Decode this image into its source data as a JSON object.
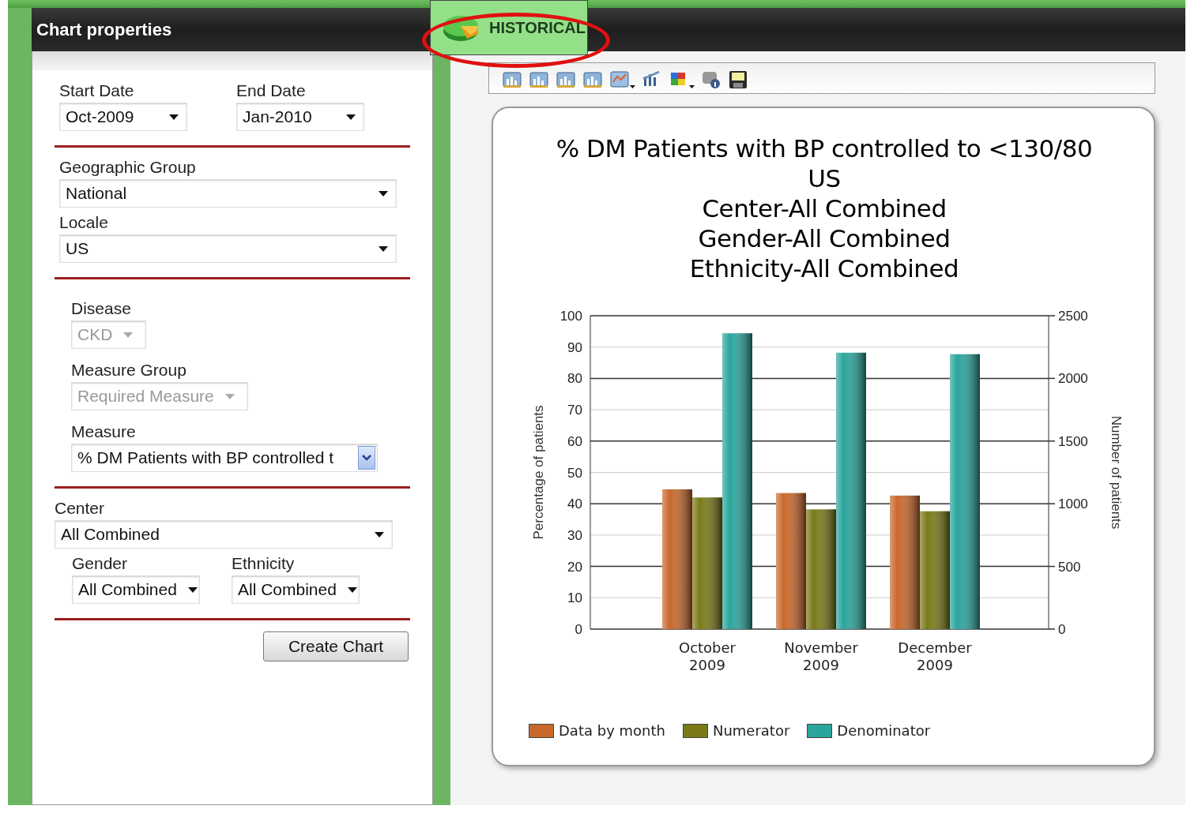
{
  "panel": {
    "title": "Chart properties"
  },
  "tab": {
    "label": "HISTORICAL",
    "selected": true
  },
  "form": {
    "sections": [
      {
        "rows": [
          [
            {
              "label": "Start Date",
              "value": "Oct-2009",
              "kind": "dropdown",
              "disabled": false
            },
            {
              "label": "End Date",
              "value": "Jan-2010",
              "kind": "dropdown",
              "disabled": false
            }
          ]
        ]
      },
      {
        "rows": [
          [
            {
              "label": "Geographic Group",
              "value": "National",
              "kind": "dropdown",
              "disabled": false
            }
          ],
          [
            {
              "label": "Locale",
              "value": "US",
              "kind": "dropdown",
              "disabled": false
            }
          ]
        ]
      },
      {
        "rows": [
          [
            {
              "label": "Disease",
              "value": "CKD",
              "kind": "dropdown",
              "disabled": true
            }
          ],
          [
            {
              "label": "Measure Group",
              "value": "Required Measure",
              "kind": "dropdown",
              "disabled": true
            }
          ],
          [
            {
              "label": "Measure",
              "value": "% DM Patients with BP controlled t",
              "kind": "combo",
              "disabled": false
            }
          ]
        ]
      },
      {
        "rows": [
          [
            {
              "label": "Center",
              "value": "All Combined",
              "kind": "dropdown",
              "disabled": false
            }
          ],
          [
            {
              "label": "Gender",
              "value": "All Combined",
              "kind": "dropdown",
              "disabled": false
            },
            {
              "label": "Ethnicity",
              "value": "All Combined",
              "kind": "dropdown",
              "disabled": false
            }
          ]
        ]
      }
    ],
    "button": "Create Chart"
  },
  "toolbar": [
    {
      "kind": "bars",
      "menu": false
    },
    {
      "kind": "bars",
      "menu": false
    },
    {
      "kind": "bars",
      "menu": false
    },
    {
      "kind": "bars",
      "menu": false
    },
    {
      "kind": "linechart",
      "menu": true
    },
    {
      "kind": "trend",
      "menu": false
    },
    {
      "kind": "palette",
      "menu": true
    },
    {
      "kind": "info",
      "menu": false
    },
    {
      "kind": "save",
      "menu": false
    }
  ],
  "chart_data": {
    "type": "bar",
    "title": "% DM Patients with BP controlled to <130/80\nUS\nCenter-All Combined\nGender-All Combined\nEthnicity-All Combined",
    "ylabel": "Percentage of patients",
    "y2label": "Number of patients",
    "categories": [
      "October\n2009",
      "November\n2009",
      "December\n2009"
    ],
    "series": [
      {
        "name": "Data by month",
        "color": "#c8682a",
        "values": [
          44.6,
          43.4,
          42.6
        ]
      },
      {
        "name": "Numerator",
        "color": "#7a7a18",
        "axis": "y2",
        "values": [
          1050,
          955,
          940
        ]
      },
      {
        "name": "Denominator",
        "color": "#2aa59c",
        "axis": "y2",
        "values": [
          2360,
          2205,
          2193
        ]
      }
    ],
    "grid": true,
    "legend": true,
    "ylim": [
      0,
      100
    ],
    "yticks": [
      0,
      10,
      20,
      30,
      40,
      50,
      60,
      70,
      80,
      90,
      100
    ],
    "y2lim": [
      0,
      2500
    ],
    "y2ticks": [
      0,
      500,
      1000,
      1500,
      2000,
      2500
    ]
  }
}
